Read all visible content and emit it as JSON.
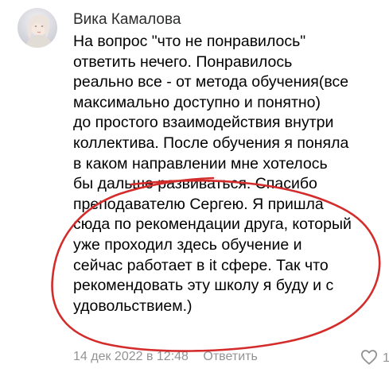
{
  "comment": {
    "author": "Вика Камалова",
    "text_lines": [
      "На вопрос \"что не понравилось\"",
      "ответить нечего. Понравилось",
      "реально все - от метода обучения(все",
      "максимально доступно и понятно)",
      "до простого взаимодействия внутри",
      "коллектива. После обучения я поняла",
      "в каком направлении мне хотелось",
      "бы дальше развиваться. Спасибо",
      "преподавателю Сергею. Я пришла",
      "сюда по рекомендации друга, который",
      "уже проходил здесь обучение и",
      "сейчас работает в it сфере. Так что",
      "рекомендовать эту школу я буду и с",
      "удовольствием.)"
    ],
    "date": "14 дек 2022 в 12:48",
    "reply_label": "Ответить",
    "like_count": "1",
    "like_icon": "heart-outline-icon"
  },
  "colors": {
    "text": "#000000",
    "muted": "#939393",
    "annotation_ink": "#d42b2b"
  }
}
